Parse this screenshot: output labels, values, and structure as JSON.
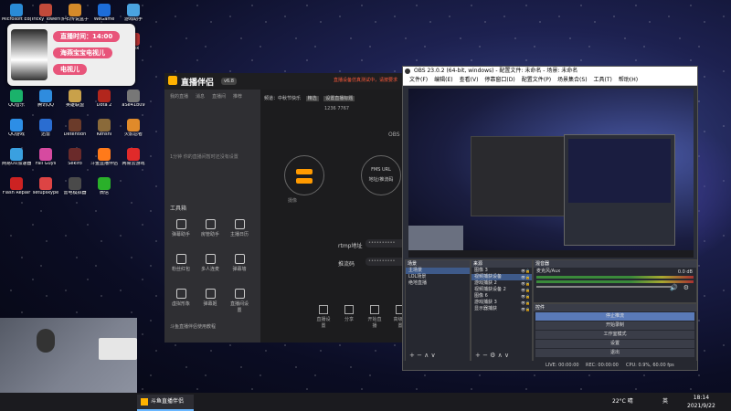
{
  "desktop": {
    "icons": [
      {
        "label": "Microsoft Edge",
        "color": "#2a8bd6"
      },
      {
        "label": "Tricky Towers",
        "color": "#c24a3a"
      },
      {
        "label": "炉石传说盒子",
        "color": "#d48a2a"
      },
      {
        "label": "WeGame",
        "color": "#1d6dd8"
      },
      {
        "label": "游戏助手",
        "color": "#4aa3e0"
      },
      {
        "label": "Steam",
        "color": "#1b2838"
      },
      {
        "label": "Counter-Strike",
        "color": "#5a5a5a"
      },
      {
        "label": "WPS Office",
        "color": "#d33"
      },
      {
        "label": "网易云",
        "color": "#d22"
      },
      {
        "label": "Apex",
        "color": "#b33"
      },
      {
        "label": "QQ音乐",
        "color": "#1ab26b"
      },
      {
        "label": "腾讯QQ",
        "color": "#2f8cde"
      },
      {
        "label": "英雄联盟",
        "color": "#c9a14a"
      },
      {
        "label": "Dota 2",
        "color": "#b2261d"
      },
      {
        "label": "aSe41b09",
        "color": "#777"
      },
      {
        "label": "QQ游戏",
        "color": "#2d8ee6"
      },
      {
        "label": "迅雷",
        "color": "#2a6dd1"
      },
      {
        "label": "Detention",
        "color": "#6b3b2a"
      },
      {
        "label": "Kenshi",
        "color": "#8a6a3a"
      },
      {
        "label": "火影忍者",
        "color": "#e08a2a"
      },
      {
        "label": "网易UU加速器",
        "color": "#3aa0e0"
      },
      {
        "label": "Fall Guys",
        "color": "#d64aa0"
      },
      {
        "label": "Sekiro",
        "color": "#6a2a2a"
      },
      {
        "label": "斗鱼直播伴侣",
        "color": "#ff7a1a"
      },
      {
        "label": "网易云游戏",
        "color": "#e02a2a"
      },
      {
        "label": "Flash Repair",
        "color": "#c22"
      },
      {
        "label": "setupskype",
        "color": "#d44"
      },
      {
        "label": "雷电模拟器",
        "color": "#4a4a4a"
      },
      {
        "label": "微信",
        "color": "#2ab02a"
      }
    ]
  },
  "overlay": {
    "pill1": "直播时间：14:00",
    "pill2": "海燕宝宝电视儿",
    "pill3": "电视儿"
  },
  "assistant": {
    "title": "直播伴侣",
    "version": "v6.8",
    "banner": "直播设备仿真测试中，请按要求",
    "tabs": [
      "我的直播",
      "消息",
      "直播间",
      "推荐"
    ],
    "channel_label": "频道：",
    "channel_value": "中秋节快乐",
    "channel_tag": "精选",
    "broadcast_btn": "设置直播标题",
    "empty_hint": "1分钟 你的直播间暂时还没有设置",
    "tools_title": "工具箱",
    "tools": [
      {
        "label": "弹幕助手"
      },
      {
        "label": "房管助手"
      },
      {
        "label": "主播日历"
      },
      {
        "label": "粉丝红包"
      },
      {
        "label": "多人连麦"
      },
      {
        "label": "弹幕墙"
      },
      {
        "label": "虚拟形象"
      },
      {
        "label": "弹幕姬"
      },
      {
        "label": "直播间设置"
      }
    ],
    "footer": "斗鱼直播伴侣使用教程",
    "stats": [
      "1236",
      "7767"
    ],
    "obs_label": "OBS",
    "mode_left": "摄像",
    "mode_right": "FMS URL",
    "mode_right_sub": "地址/推流码",
    "rtmp_label": "rtmp地址",
    "key_label": "推流码",
    "input_mask": "••••••••••",
    "bottom_btns": [
      "直播设置",
      "分享",
      "开始直播",
      "高级设置"
    ]
  },
  "obs": {
    "title": "OBS 23.0.2 (64-bit, windows) - 配置文件: 未命名 - 场景: 未命名",
    "menu": [
      "文件(F)",
      "编辑(E)",
      "查看(V)",
      "停靠窗口(D)",
      "配置文件(P)",
      "场景集合(S)",
      "工具(T)",
      "帮助(H)"
    ],
    "panels": {
      "scenes": {
        "title": "场景",
        "items": [
          "主场景",
          "LOL场景",
          "绝地直播"
        ]
      },
      "sources": {
        "title": "来源",
        "items": [
          "图像 3",
          "视频捕获设备",
          "游戏捕获 2",
          "视频捕获设备 2",
          "图像 6",
          "游戏捕获 3",
          "显示器捕获"
        ]
      },
      "mixer": {
        "title": "混音器",
        "track": "麦克风/Aux",
        "level": "0.0 dB",
        "level2": "0.0 dB"
      },
      "controls": {
        "title": "控件",
        "buttons": [
          "停止推流",
          "开始录制",
          "工作室模式",
          "设置",
          "退出"
        ]
      }
    },
    "status": {
      "live": "LIVE: 00:00:00",
      "rec": "REC: 00:00:00",
      "cpu": "CPU: 0.9%, 60.00 fps"
    }
  },
  "taskbar": {
    "app_label": "斗鱼直播伴侣",
    "weather": "22°C 晴",
    "time": "18:14",
    "date": "2021/9/22",
    "lang": "英"
  }
}
